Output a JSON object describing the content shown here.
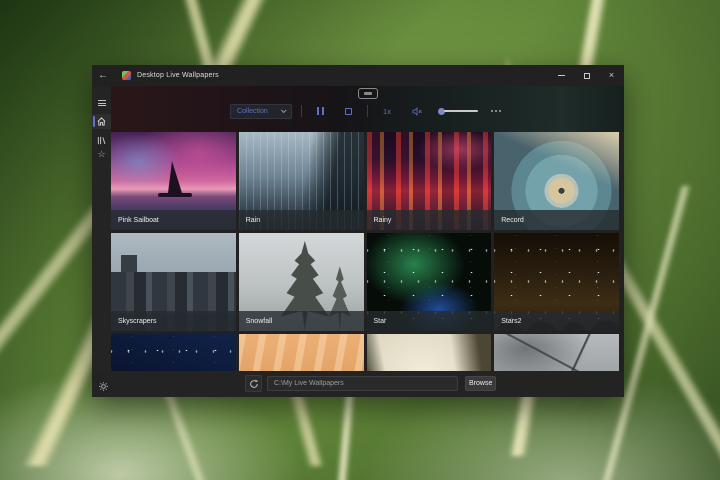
{
  "colors": {
    "accent_blue": "#5d72c6",
    "window_bg": "#212121",
    "bottom_bar_bg": "#232323"
  },
  "window": {
    "title": "Desktop Live Wallpapers",
    "controls": [
      {
        "name": "minimize"
      },
      {
        "name": "maximize"
      },
      {
        "name": "close",
        "glyph": "×"
      }
    ]
  },
  "sidebar": {
    "items": [
      {
        "name": "menu",
        "icon": "hamburger-icon",
        "selected": false
      },
      {
        "name": "home",
        "icon": "home-icon",
        "selected": true
      },
      {
        "name": "library",
        "icon": "library-icon",
        "selected": false
      },
      {
        "name": "favorites",
        "icon": "star-icon",
        "glyph": "☆",
        "selected": false
      }
    ],
    "settings_icon": "gear-icon",
    "settings_glyph": "⚙"
  },
  "toolbar": {
    "collection_label": "Collection",
    "pause_icon": "pause-icon",
    "stop_icon": "stop-icon",
    "speed_label": "1x",
    "mute_icon": "speaker-mute-icon",
    "volume_value": 0,
    "more_icon": "ellipsis-icon"
  },
  "wallpapers": [
    {
      "label": "Pink Sailboat",
      "art": "pink-sailboat"
    },
    {
      "label": "Rain",
      "art": "rain"
    },
    {
      "label": "Rainy",
      "art": "rainy"
    },
    {
      "label": "Record",
      "art": "record"
    },
    {
      "label": "Skyscrapers",
      "art": "skyscrapers"
    },
    {
      "label": "Snowfall",
      "art": "snowfall"
    },
    {
      "label": "Star",
      "art": "star"
    },
    {
      "label": "Stars2",
      "art": "stars2"
    },
    {
      "label": "",
      "art": "night-sky"
    },
    {
      "label": "",
      "art": "sunset-clouds"
    },
    {
      "label": "",
      "art": "valley"
    },
    {
      "label": "",
      "art": "wind-turbine"
    }
  ],
  "bottom_bar": {
    "refresh_icon": "refresh-icon",
    "path_value": "C:\\My Live Wallpapers",
    "browse_label": "Browse"
  }
}
